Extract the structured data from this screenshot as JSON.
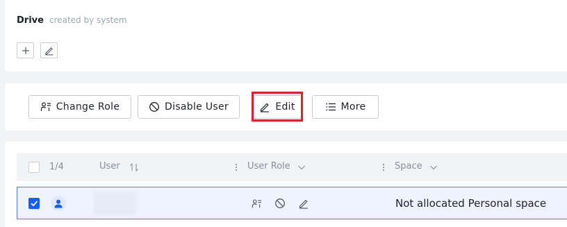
{
  "header": {
    "title": "Drive",
    "subtitle": "created by system",
    "add_icon": "plus-icon",
    "edit_icon": "pencil-icon"
  },
  "toolbar": {
    "buttons": [
      {
        "label": "Change Role",
        "icon": "user-role-icon"
      },
      {
        "label": "Disable User",
        "icon": "ban-icon"
      },
      {
        "label": "Edit",
        "icon": "pencil-icon",
        "highlighted": true
      },
      {
        "label": "More",
        "icon": "list-icon"
      }
    ],
    "highlight_color": "#e0202a"
  },
  "table": {
    "selection_count": "1/4",
    "columns": [
      {
        "label": "User",
        "icon": "sort-icon"
      },
      {
        "label": "User Role",
        "icon": "chevron-down-icon"
      },
      {
        "label": "Space",
        "icon": "chevron-down-icon"
      }
    ],
    "rows": [
      {
        "selected": true,
        "user": "",
        "space": "Not allocated Personal space"
      }
    ]
  },
  "colors": {
    "accent": "#165dff",
    "selected_row_bg": "#eef3ff",
    "selected_row_border": "#4d7ff0"
  }
}
